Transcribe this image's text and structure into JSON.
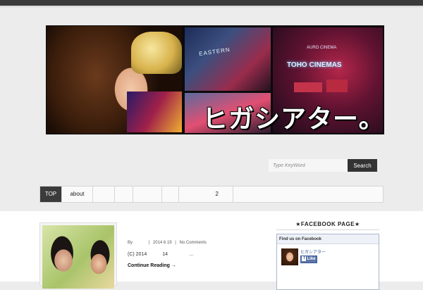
{
  "banner": {
    "title": "ヒガシアター。",
    "sign_text": "EASTERN",
    "toho_text": "TOHO CINEMAS",
    "auro_text": "AURO CINEMA"
  },
  "search": {
    "placeholder": "Type KeyWord",
    "button_label": "Search"
  },
  "nav": {
    "items": [
      {
        "label": "TOP",
        "active": true
      },
      {
        "label": "about"
      },
      {
        "label": ""
      },
      {
        "label": ""
      },
      {
        "label": ""
      },
      {
        "label": ""
      },
      {
        "label": "2"
      },
      {
        "label": ""
      }
    ]
  },
  "post": {
    "by": "By",
    "sep1": "|",
    "date": "2014 6 19",
    "sep2": "|",
    "comments": "No Comments",
    "excerpt_copyright": "(C) 2014",
    "excerpt_num": "14",
    "excerpt_ellipsis": "…",
    "continue": "Continue Reading →"
  },
  "facebook": {
    "section_title": "★FACEBOOK PAGE★",
    "header": "Find us on Facebook",
    "page_name": "ヒガシアター",
    "like_label": "Like"
  }
}
